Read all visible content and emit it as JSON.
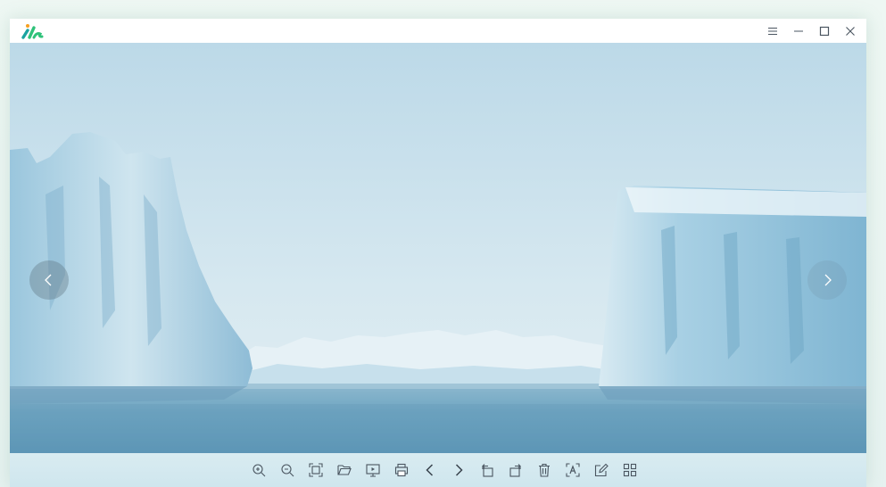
{
  "app": {
    "logo_icon": "app-logo-icon",
    "colors": {
      "logo_green": "#2fc27a",
      "logo_teal": "#1aa3a0",
      "logo_orange": "#f6a021",
      "icon": "#4a5560"
    }
  },
  "titlebar": {
    "controls": [
      {
        "name": "menu-icon"
      },
      {
        "name": "minimize-icon"
      },
      {
        "name": "maximize-icon"
      },
      {
        "name": "close-icon"
      }
    ]
  },
  "viewer": {
    "image_description_icon": "photo-iceberg"
  },
  "toolbar": {
    "tools": [
      "zoom-in-icon",
      "zoom-out-icon",
      "fit-to-screen-icon",
      "open-folder-icon",
      "slideshow-icon",
      "print-icon",
      "previous-icon",
      "next-icon",
      "rotate-left-icon",
      "rotate-right-icon",
      "delete-icon",
      "ocr-text-icon",
      "edit-icon",
      "thumbnails-grid-icon"
    ]
  }
}
